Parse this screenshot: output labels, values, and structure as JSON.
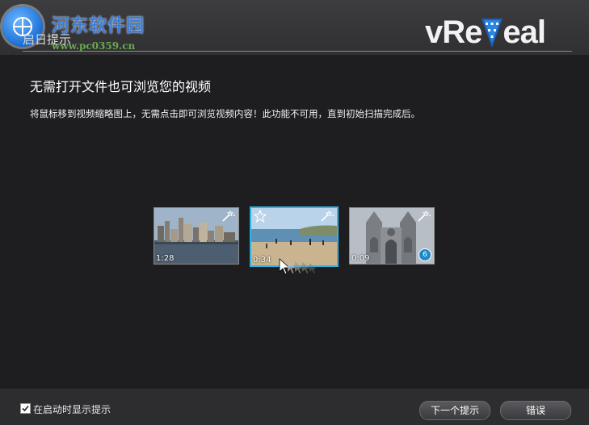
{
  "watermark": {
    "title": "河东软件园",
    "url": "www.pc0359.cn"
  },
  "window": {
    "title": "启日提示"
  },
  "brand": {
    "left": "vRe",
    "right": "eal"
  },
  "tip": {
    "title": "无需打开文件也可浏览您的视频",
    "body": "将鼠标移到视频缩略图上，无需点击即可浏览视频内容！此功能不可用，直到初始扫描完成后。"
  },
  "thumbnails": [
    {
      "duration": "1:28",
      "scene": "city-skyline",
      "selected": false,
      "badge": ""
    },
    {
      "duration": "0:34",
      "scene": "beach",
      "selected": true,
      "badge": ""
    },
    {
      "duration": "0:09",
      "scene": "cathedral",
      "selected": false,
      "badge": "6"
    }
  ],
  "footer": {
    "checkbox_label": "在启动时显示提示",
    "checkbox_checked": true,
    "next_label": "下一个提示",
    "close_label": "错误"
  },
  "colors": {
    "accent": "#2fb4e8",
    "background": "#1e1e20"
  }
}
